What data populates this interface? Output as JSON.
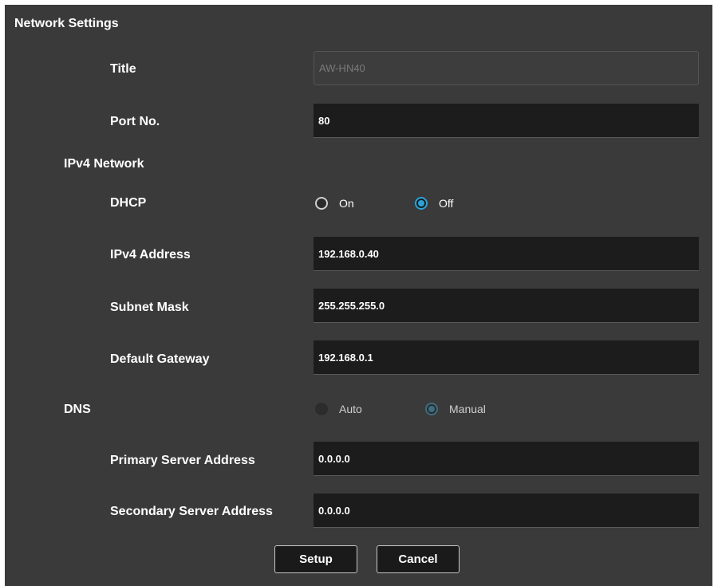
{
  "header": {
    "title": "Network Settings"
  },
  "fields": {
    "title": {
      "label": "Title",
      "value": "AW-HN40"
    },
    "port": {
      "label": "Port No.",
      "value": "80"
    },
    "ipv4_section": {
      "label": "IPv4 Network"
    },
    "dhcp": {
      "label": "DHCP",
      "on_label": "On",
      "off_label": "Off",
      "selected": "Off"
    },
    "ipv4_address": {
      "label": "IPv4 Address",
      "value": "192.168.0.40"
    },
    "subnet_mask": {
      "label": "Subnet Mask",
      "value": "255.255.255.0"
    },
    "default_gateway": {
      "label": "Default Gateway",
      "value": "192.168.0.1"
    },
    "dns": {
      "label": "DNS",
      "auto_label": "Auto",
      "manual_label": "Manual",
      "selected": "Manual"
    },
    "primary_server": {
      "label": "Primary Server Address",
      "value": "0.0.0.0"
    },
    "secondary_server": {
      "label": "Secondary Server Address",
      "value": "0.0.0.0"
    }
  },
  "buttons": {
    "setup_label": "Setup",
    "cancel_label": "Cancel"
  },
  "colors": {
    "panel_bg": "#3a3a3a",
    "field_bg": "#1c1c1c",
    "accent": "#29a3d8"
  }
}
